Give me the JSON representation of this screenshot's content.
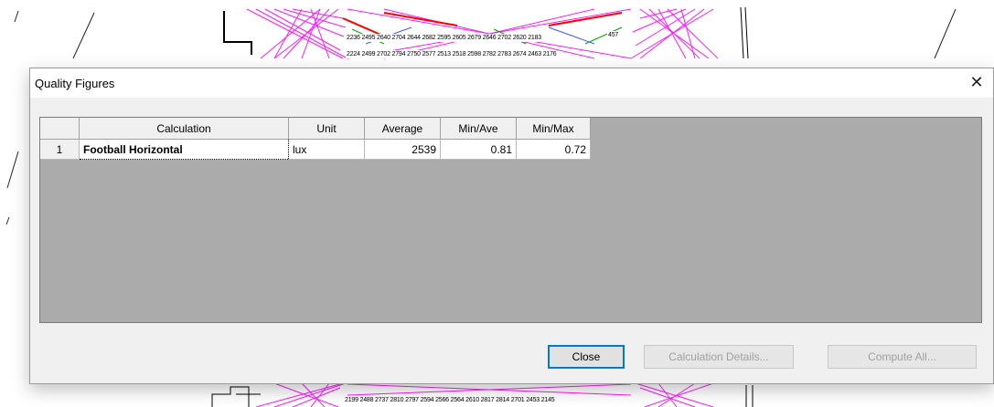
{
  "background": {
    "top_rows": [
      "2236 2495 2640 2704 2644 2682 2595 2605 2679 2646 2702 2620 2183",
      "2224 2499 2702 2794 2750 2577 2513 2518 2598 2782 2783 2674 2463 2176"
    ],
    "top_side_value": "457",
    "bottom_row": "2199 2488 2737 2810 2797 2594 2566 2564 2610 2817 2814 2701 2453 2145",
    "accent_color": "#ff00ff",
    "secondary_color": "#ff0000"
  },
  "dialog": {
    "title": "Quality Figures",
    "close_glyph": "✕",
    "table": {
      "headers": [
        "Calculation",
        "Unit",
        "Average",
        "Min/Ave",
        "Min/Max"
      ],
      "rows": [
        {
          "num": "1",
          "calculation": "Football Horizontal",
          "unit": "lux",
          "average": "2539",
          "min_ave": "0.81",
          "min_max": "0.72"
        }
      ]
    },
    "buttons": {
      "close": "Close",
      "details": "Calculation Details...",
      "compute": "Compute All..."
    }
  }
}
